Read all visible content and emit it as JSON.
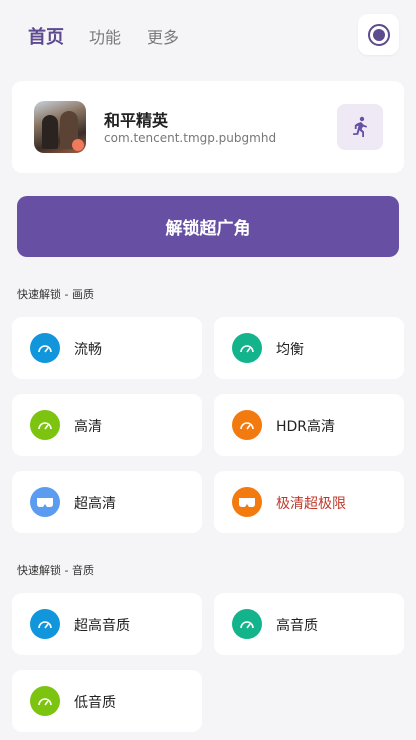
{
  "tabs": [
    {
      "label": "首页"
    },
    {
      "label": "功能"
    },
    {
      "label": "更多"
    }
  ],
  "app": {
    "name": "和平精英",
    "package": "com.tencent.tmgp.pubgmhd"
  },
  "unlock_button": "解锁超广角",
  "sections": {
    "graphics": {
      "title": "快速解锁 - 画质",
      "options": [
        {
          "label": "流畅",
          "color": "#1296db",
          "icon": "speedometer-icon"
        },
        {
          "label": "均衡",
          "color": "#13b48c",
          "icon": "speedometer-icon"
        },
        {
          "label": "高清",
          "color": "#7cc40f",
          "icon": "speedometer-icon"
        },
        {
          "label": "HDR高清",
          "color": "#f27a0f",
          "icon": "speedometer-icon"
        },
        {
          "label": "超高清",
          "color": "#5b9cf0",
          "icon": "vr-goggles-icon"
        },
        {
          "label": "极清超极限",
          "color": "#f27a0f",
          "icon": "vr-goggles-icon",
          "text_color": "#c0392b"
        }
      ]
    },
    "audio": {
      "title": "快速解锁 - 音质",
      "options": [
        {
          "label": "超高音质",
          "color": "#1296db",
          "icon": "speedometer-icon"
        },
        {
          "label": "高音质",
          "color": "#13b48c",
          "icon": "speedometer-icon"
        },
        {
          "label": "低音质",
          "color": "#7cc40f",
          "icon": "speedometer-icon"
        }
      ]
    }
  },
  "colors": {
    "accent": "#6750a4",
    "background": "#f5f5f7"
  }
}
